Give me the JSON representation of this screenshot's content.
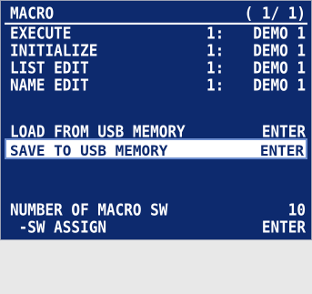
{
  "menu": {
    "title": "MACRO",
    "page": "( 1/ 1)",
    "items": [
      {
        "label": "EXECUTE",
        "num": "1:",
        "value": "DEMO 1"
      },
      {
        "label": "INITIALIZE",
        "num": "1:",
        "value": "DEMO 1"
      },
      {
        "label": "LIST EDIT",
        "num": "1:",
        "value": "DEMO 1"
      },
      {
        "label": "NAME EDIT",
        "num": "1:",
        "value": "DEMO 1"
      },
      {
        "label": "LOAD FROM USB MEMORY",
        "value": "ENTER"
      },
      {
        "label": "SAVE TO USB MEMORY",
        "value": "ENTER"
      },
      {
        "label": "NUMBER OF MACRO SW",
        "value": "10"
      },
      {
        "label": " -SW ASSIGN",
        "value": "ENTER"
      }
    ]
  },
  "colors": {
    "background": "#0d2a6e",
    "text": "#ffffff",
    "selected_background": "#ffffff",
    "selected_text": "#0d2a6e"
  }
}
